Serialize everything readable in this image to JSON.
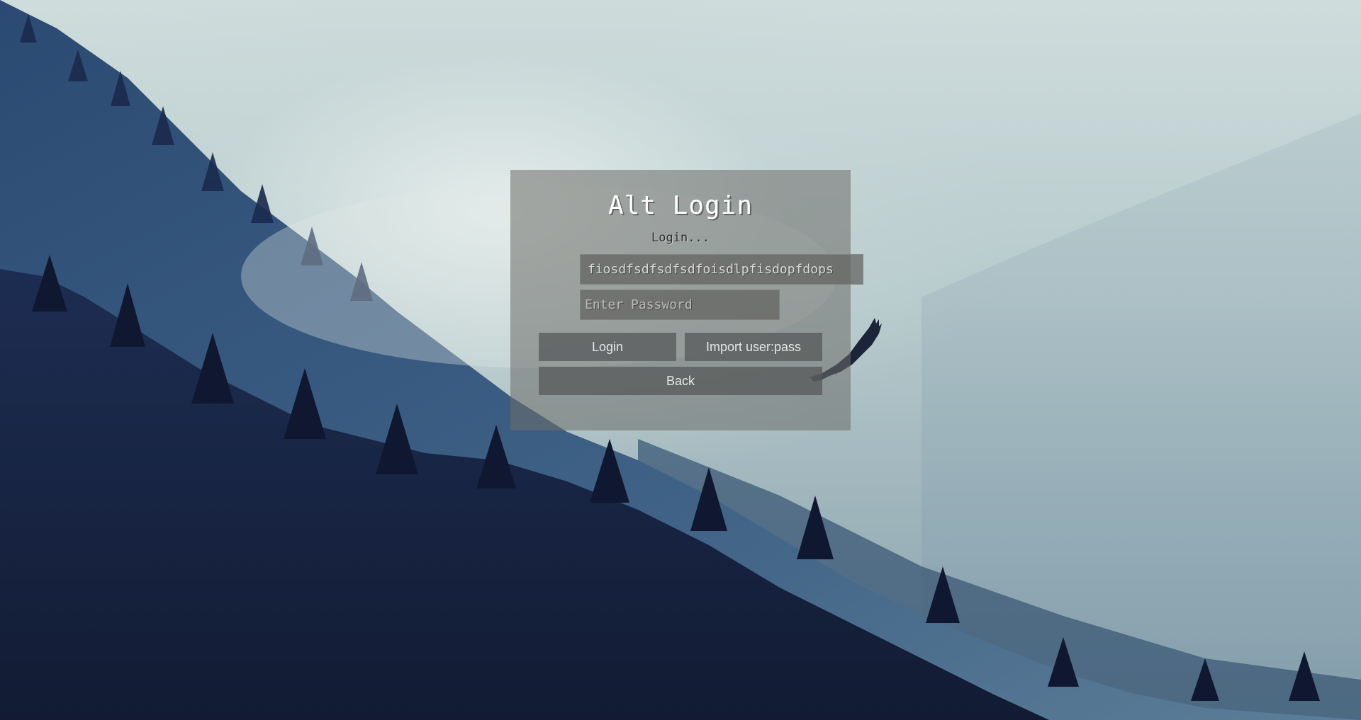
{
  "window": {
    "title": "Alt Login",
    "status": "Login..."
  },
  "form": {
    "username_value": "fiosdfsdfsdfsdfoisdlpfisdopfdops",
    "password_placeholder": "Enter Password"
  },
  "buttons": {
    "login_label": "Login",
    "import_label": "Import user:pass",
    "back_label": "Back"
  },
  "colors": {
    "panel": "#6e6e69",
    "forest_dark": "#16203c",
    "sky": "#cfdcdc"
  },
  "background": {
    "scene": "misty-forest-with-eagle"
  }
}
